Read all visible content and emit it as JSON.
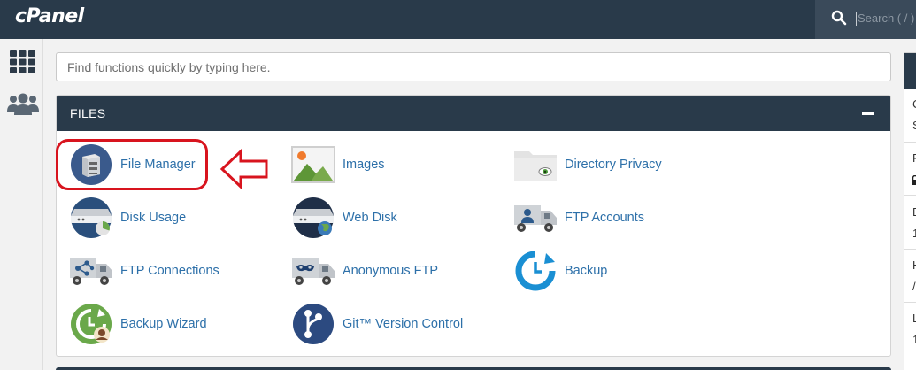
{
  "app": {
    "logo_text": "cPanel",
    "search_placeholder": "Search ( / )"
  },
  "rail": {
    "icons": [
      "apps-grid-icon",
      "users-icon"
    ]
  },
  "find": {
    "placeholder": "Find functions quickly by typing here."
  },
  "files_panel": {
    "title": "FILES",
    "collapse_icon": "minus-icon",
    "items": [
      {
        "label": "File Manager",
        "icon": "file-manager-icon"
      },
      {
        "label": "Images",
        "icon": "images-icon"
      },
      {
        "label": "Directory Privacy",
        "icon": "directory-privacy-icon"
      },
      {
        "label": "Disk Usage",
        "icon": "disk-usage-icon"
      },
      {
        "label": "Web Disk",
        "icon": "web-disk-icon"
      },
      {
        "label": "FTP Accounts",
        "icon": "ftp-accounts-icon"
      },
      {
        "label": "FTP Connections",
        "icon": "ftp-connections-icon"
      },
      {
        "label": "Anonymous FTP",
        "icon": "anonymous-ftp-icon"
      },
      {
        "label": "Backup",
        "icon": "backup-icon"
      },
      {
        "label": "Backup Wizard",
        "icon": "backup-wizard-icon"
      },
      {
        "label": "Git™ Version Control",
        "icon": "git-version-control-icon"
      }
    ]
  },
  "right_sidebar": {
    "visible_fragments": [
      "C",
      "S",
      "F",
      "D",
      "1",
      "H",
      "/",
      "L",
      "1"
    ]
  },
  "colors": {
    "topbar": "#293a4a",
    "link": "#2d70a9",
    "annotation": "#d8141e"
  }
}
